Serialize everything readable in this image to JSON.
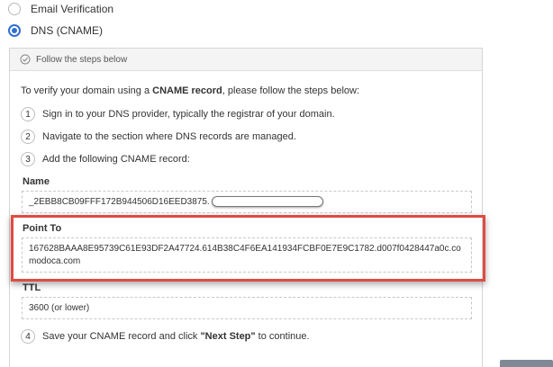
{
  "options": [
    {
      "label": "Email Verification",
      "checked": false
    },
    {
      "label": "DNS (CNAME)",
      "checked": true
    }
  ],
  "card": {
    "header": "Follow the steps below",
    "intro_prefix": "To verify your domain using a ",
    "intro_bold": "CNAME record",
    "intro_suffix": ", please follow the steps below:",
    "steps": [
      {
        "num": "1",
        "text": "Sign in to your DNS provider, typically the registrar of your domain."
      },
      {
        "num": "2",
        "text": "Navigate to the section where DNS records are managed."
      },
      {
        "num": "3",
        "text": "Add the following CNAME record:"
      }
    ],
    "name_label": "Name",
    "name_value": "_2EBB8CB09FFF172B944506D16EED3875.",
    "point_label": "Point To",
    "point_value": "167628BAAA8E95739C61E93DF2A47724.614B38C4F6EA141934FCBF0E7E9C1782.d007f0428447a0c.comodoca.com",
    "ttl_label": "TTL",
    "ttl_value": "3600 (or lower)",
    "final_step": {
      "num": "4",
      "prefix": "Save your CNAME record and click ",
      "bold": "\"Next Step\"",
      "suffix": " to continue."
    }
  }
}
